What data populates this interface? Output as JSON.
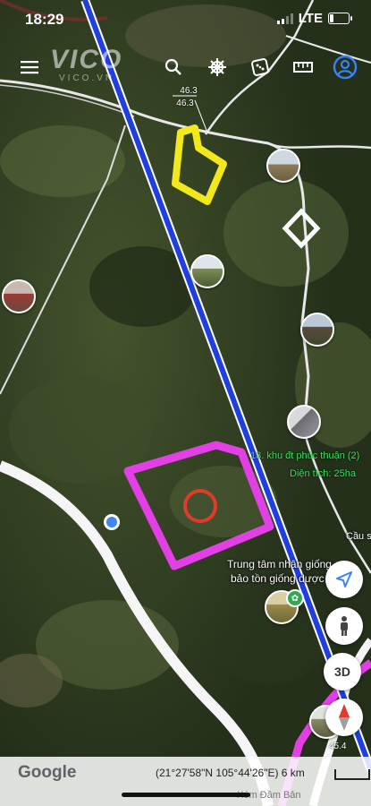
{
  "status": {
    "time": "18:29",
    "network": "LTE",
    "battery_level": 0.22
  },
  "watermark": {
    "main": "VICO",
    "sub": "VICO.VN"
  },
  "toolbar": {
    "menu_icon": "hamburger-menu-icon",
    "search_icon": "search-icon",
    "steering_icon": "ship-wheel-icon",
    "dice_icon": "dice-icon",
    "ruler_icon": "ruler-icon",
    "profile_icon": "account-icon",
    "accent": "#3b82f6"
  },
  "map": {
    "ruler_top": "46.3",
    "ruler_bottom": "46.3",
    "ruler_bottom_right": "45.4",
    "label_area_title": "13. khu đt phúc thuận (2)",
    "label_area_size": "Diện tích: 25ha",
    "label_center_line1": "Trung tâm nhân giống",
    "label_center_line2": "bảo tồn giống dược",
    "label_cau": "Cầu s",
    "colors": {
      "polygon": "#e33fe6",
      "yellow_marker": "#f2e81a",
      "powerline": "#1f3fe0",
      "road": "#f5f5f5",
      "target": "#e23a2a"
    }
  },
  "controls": {
    "three_d": "3D",
    "compass_icon": "compass-icon",
    "location_icon": "navigation-arrow-icon",
    "pegman_icon": "pegman-icon"
  },
  "bottom": {
    "logo": "Google",
    "coords": "(21°27'58\"N 105°44'26\"E) 6 km",
    "place": "Xóm Đầm Bản"
  }
}
